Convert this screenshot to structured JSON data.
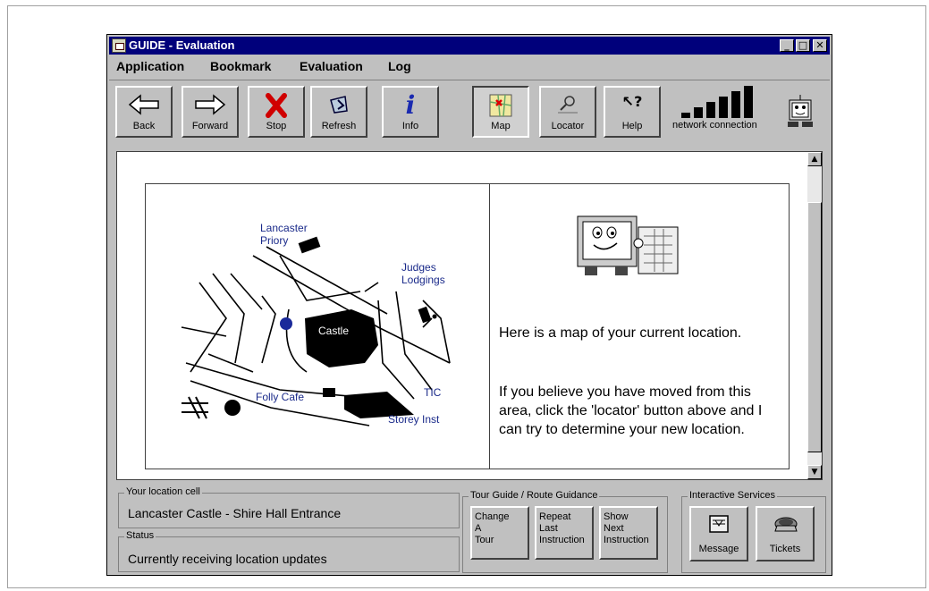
{
  "window": {
    "title": "GUIDE - Evaluation",
    "controls": {
      "minimize": "_",
      "maximize": "□",
      "close": "✕"
    }
  },
  "menu": [
    "Application",
    "Bookmark",
    "Evaluation",
    "Log"
  ],
  "toolbar": {
    "back": "Back",
    "forward": "Forward",
    "stop": "Stop",
    "refresh": "Refresh",
    "info": "Info",
    "map": "Map",
    "locator": "Locator",
    "help": "Help",
    "network_label": "network connection"
  },
  "map": {
    "labels": {
      "priory": "Lancaster\nPriory",
      "judges": "Judges\nLodgings",
      "castle": "Castle",
      "folly": "Folly Cafe",
      "tic": "TIC",
      "storey": "Storey Inst"
    }
  },
  "info": {
    "paragraph1": "Here is a map of your current location.",
    "paragraph2": "If you believe you have moved from this area, click the 'locator' button above and I can try to determine your new location."
  },
  "location": {
    "group_title": "Your location cell",
    "value": "Lancaster Castle - Shire Hall Entrance"
  },
  "status": {
    "group_title": "Status",
    "value": "Currently receiving location updates"
  },
  "tour": {
    "group_title": "Tour Guide / Route Guidance",
    "buttons": [
      [
        "Change",
        "A",
        "Tour"
      ],
      [
        "Repeat",
        "Last",
        "Instruction"
      ],
      [
        "Show",
        "Next",
        "Instruction"
      ]
    ]
  },
  "services": {
    "group_title": "Interactive Services",
    "message": "Message",
    "tickets": "Tickets"
  }
}
